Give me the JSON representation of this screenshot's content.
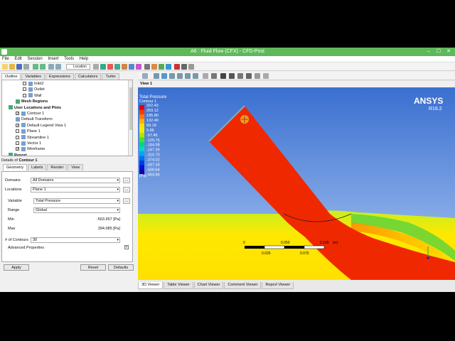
{
  "window": {
    "title": "A6 : Fluid Flow (CFX) - CFD-Post"
  },
  "menu": [
    "File",
    "Edit",
    "Session",
    "Insert",
    "Tools",
    "Help"
  ],
  "toolbar": {
    "location_label": "Location"
  },
  "left_tabs": [
    "Outline",
    "Variables",
    "Expressions",
    "Calculators",
    "Turbo"
  ],
  "tree": [
    {
      "label": "Inlet2",
      "indent": 5,
      "check": true,
      "checked": false
    },
    {
      "label": "Outlet",
      "indent": 5,
      "check": true,
      "checked": false
    },
    {
      "label": "Wall",
      "indent": 5,
      "check": true,
      "checked": false
    },
    {
      "label": "Mesh Regions",
      "indent": 3,
      "check": false,
      "checked": false,
      "bold": true
    },
    {
      "label": "User Locations and Plots",
      "indent": 1,
      "check": false,
      "checked": false,
      "bold": true
    },
    {
      "label": "Contour 1",
      "indent": 3,
      "check": true,
      "checked": true
    },
    {
      "label": "Default Transform",
      "indent": 3,
      "check": false,
      "checked": false
    },
    {
      "label": "Default Legend View 1",
      "indent": 3,
      "check": true,
      "checked": true
    },
    {
      "label": "Plane 1",
      "indent": 3,
      "check": true,
      "checked": false
    },
    {
      "label": "Streamline 1",
      "indent": 3,
      "check": true,
      "checked": false
    },
    {
      "label": "Vector 1",
      "indent": 3,
      "check": true,
      "checked": false
    },
    {
      "label": "Wireframe",
      "indent": 3,
      "check": true,
      "checked": true
    },
    {
      "label": "Report",
      "indent": 1,
      "check": false,
      "checked": false,
      "bold": true
    }
  ],
  "details": {
    "header_prefix": "Details of",
    "header_name": "Contour 1",
    "tabs": [
      "Geometry",
      "Labels",
      "Render",
      "View"
    ],
    "domains_label": "Domains",
    "domains_value": "All Domains",
    "locations_label": "Locations",
    "locations_value": "Plane 1",
    "variable_label": "Variable",
    "variable_value": "Total Pressure",
    "range_label": "Range",
    "range_value": "Global",
    "min_label": "Min",
    "min_value": "-563.957 [Pa]",
    "max_label": "Max",
    "max_value": "394.085 [Pa]",
    "contours_label": "# of Contours",
    "contours_value": "30",
    "advanced_label": "Advanced Properties",
    "apply": "Apply",
    "reset": "Reset",
    "defaults": "Defaults"
  },
  "viewer": {
    "view_label": "View 1",
    "legend_title": "Total Pressure",
    "legend_subtitle": "Contour 1",
    "legend_values": [
      "322.43",
      "259.12",
      "195.80",
      "132.49",
      "69.18",
      "5.86",
      "-57.45",
      "-120.76",
      "-184.08",
      "-247.39",
      "-310.70",
      "-374.02",
      "-437.33",
      "-500.64",
      "-563.96"
    ],
    "legend_unit": "[Pa]",
    "legend_colors": [
      "#e80000",
      "#ff3a00",
      "#ff7a00",
      "#ffb400",
      "#ffe000",
      "#e8f000",
      "#a8e800",
      "#50e020",
      "#00d880",
      "#00d8d0",
      "#00a8f0",
      "#0070f0",
      "#0038e8",
      "#0010d0",
      "#1000a8"
    ],
    "brand": "ANSYS",
    "version": "R16.2",
    "scale_labels": [
      "0",
      "0.050",
      "0.100",
      "(m)",
      "0.025",
      "0.075"
    ],
    "bottom_tabs": [
      "3D Viewer",
      "Table Viewer",
      "Chart Viewer",
      "Comment Viewer",
      "Report Viewer"
    ],
    "colors": {
      "high": "#f02800",
      "mid": "#ffe800",
      "low": "#c8ee20",
      "background_top": "#3a6fd0",
      "background_bottom": "#a9c6f2"
    }
  }
}
